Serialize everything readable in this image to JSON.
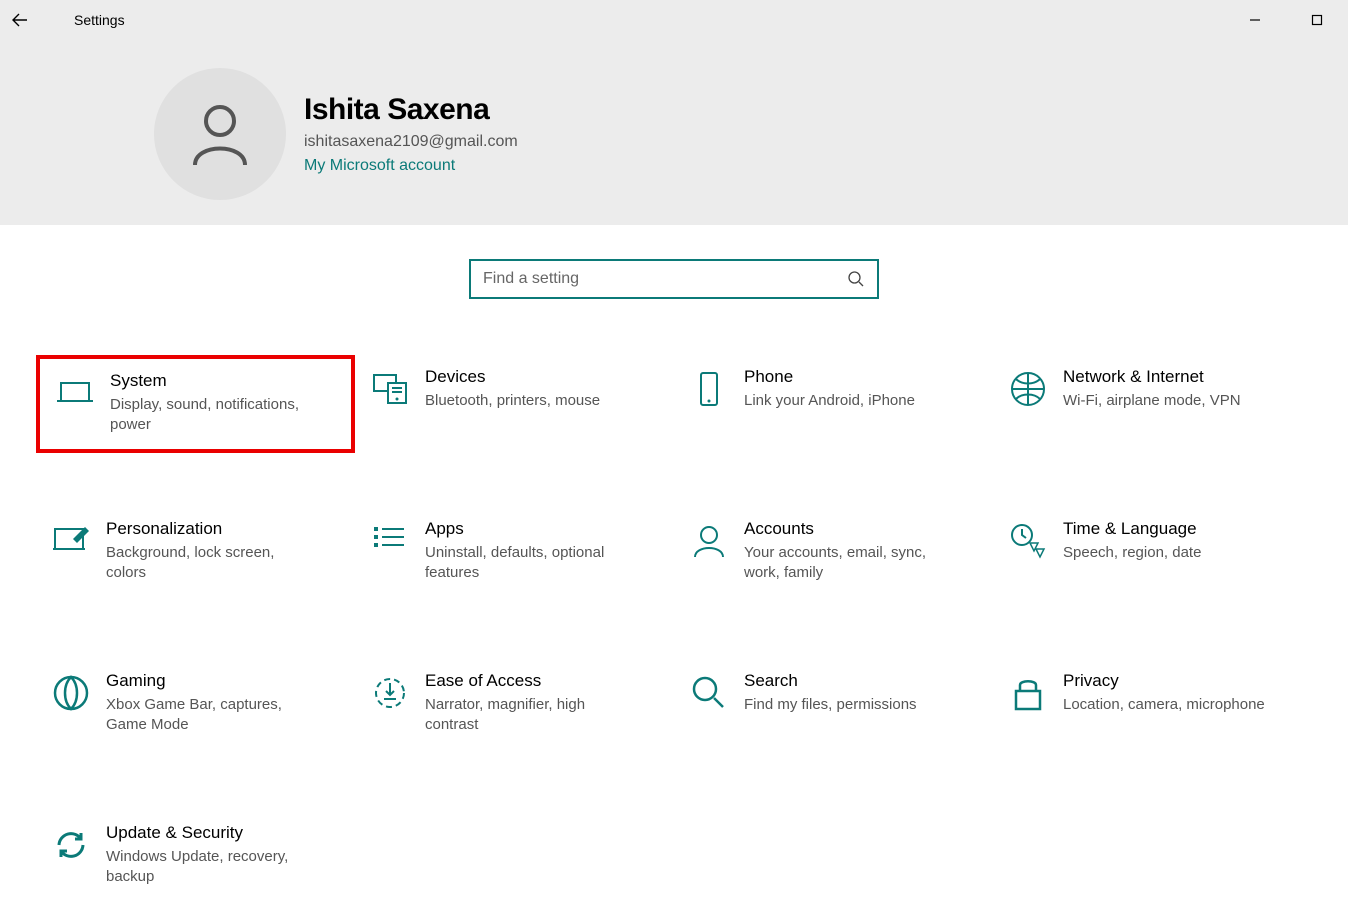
{
  "window": {
    "title": "Settings"
  },
  "user": {
    "name": "Ishita Saxena",
    "email": "ishitasaxena2109@gmail.com",
    "account_link": "My Microsoft account"
  },
  "search": {
    "placeholder": "Find a setting"
  },
  "tiles": [
    {
      "key": "system",
      "title": "System",
      "desc": "Display, sound, notifications, power",
      "highlighted": true
    },
    {
      "key": "devices",
      "title": "Devices",
      "desc": "Bluetooth, printers, mouse"
    },
    {
      "key": "phone",
      "title": "Phone",
      "desc": "Link your Android, iPhone"
    },
    {
      "key": "network",
      "title": "Network & Internet",
      "desc": "Wi-Fi, airplane mode, VPN"
    },
    {
      "key": "personalization",
      "title": "Personalization",
      "desc": "Background, lock screen, colors"
    },
    {
      "key": "apps",
      "title": "Apps",
      "desc": "Uninstall, defaults, optional features"
    },
    {
      "key": "accounts",
      "title": "Accounts",
      "desc": "Your accounts, email, sync, work, family"
    },
    {
      "key": "time",
      "title": "Time & Language",
      "desc": "Speech, region, date"
    },
    {
      "key": "gaming",
      "title": "Gaming",
      "desc": "Xbox Game Bar, captures, Game Mode"
    },
    {
      "key": "ease",
      "title": "Ease of Access",
      "desc": "Narrator, magnifier, high contrast"
    },
    {
      "key": "search",
      "title": "Search",
      "desc": "Find my files, permissions"
    },
    {
      "key": "privacy",
      "title": "Privacy",
      "desc": "Location, camera, microphone"
    },
    {
      "key": "update",
      "title": "Update & Security",
      "desc": "Windows Update, recovery, backup"
    }
  ],
  "colors": {
    "accent": "#0b7a78",
    "highlight": "#ea0000"
  }
}
